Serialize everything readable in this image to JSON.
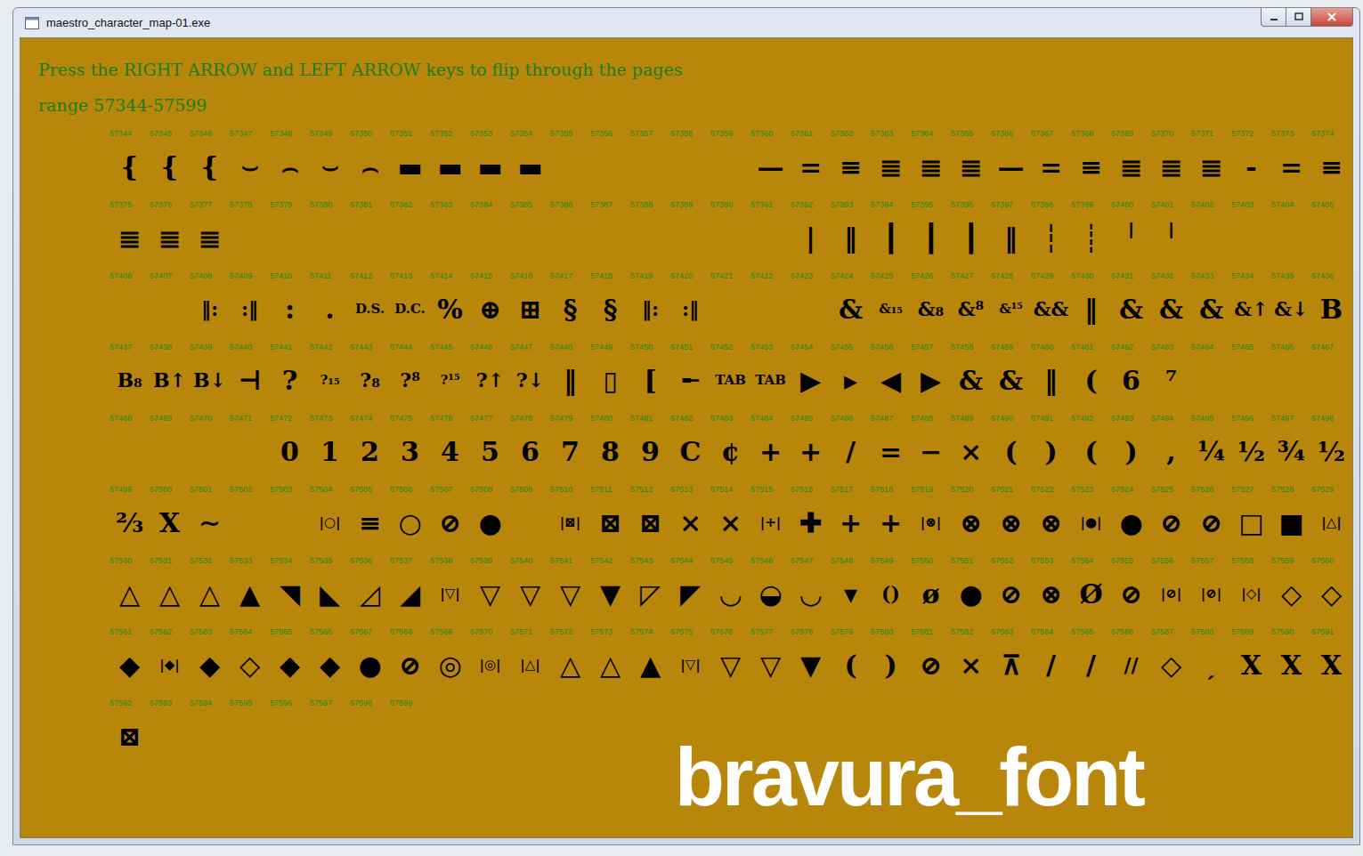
{
  "window": {
    "title": "maestro_character_map-01.exe"
  },
  "instructions": "Press the RIGHT ARROW and LEFT ARROW keys to flip through the pages",
  "range": "range 57344-57599",
  "watermark": "bravura_font",
  "rows": [
    [
      {
        "code": "57344",
        "glyph": "{"
      },
      {
        "code": "57345",
        "glyph": "{"
      },
      {
        "code": "57346",
        "glyph": "{"
      },
      {
        "code": "57347",
        "glyph": "⌣"
      },
      {
        "code": "57348",
        "glyph": "⌢"
      },
      {
        "code": "57349",
        "glyph": "⌣"
      },
      {
        "code": "57350",
        "glyph": "⌢"
      },
      {
        "code": "57351",
        "glyph": "▬"
      },
      {
        "code": "57352",
        "glyph": "▬"
      },
      {
        "code": "57353",
        "glyph": "▬"
      },
      {
        "code": "57354",
        "glyph": "▬"
      },
      {
        "code": "57355",
        "glyph": ""
      },
      {
        "code": "57356",
        "glyph": ""
      },
      {
        "code": "57357",
        "glyph": ""
      },
      {
        "code": "57358",
        "glyph": ""
      },
      {
        "code": "57359",
        "glyph": ""
      },
      {
        "code": "57360",
        "glyph": "—"
      },
      {
        "code": "57361",
        "glyph": "="
      },
      {
        "code": "57362",
        "glyph": "≡"
      },
      {
        "code": "57363",
        "glyph": "≣"
      },
      {
        "code": "57364",
        "glyph": "≣"
      },
      {
        "code": "57365",
        "glyph": "≣"
      },
      {
        "code": "57366",
        "glyph": "—"
      },
      {
        "code": "57367",
        "glyph": "="
      },
      {
        "code": "57368",
        "glyph": "≡"
      },
      {
        "code": "57369",
        "glyph": "≣"
      },
      {
        "code": "57370",
        "glyph": "≣"
      },
      {
        "code": "57371",
        "glyph": "≣"
      },
      {
        "code": "57372",
        "glyph": "-"
      },
      {
        "code": "57373",
        "glyph": "="
      },
      {
        "code": "57374",
        "glyph": "≡"
      }
    ],
    [
      {
        "code": "57375",
        "glyph": "≣"
      },
      {
        "code": "57376",
        "glyph": "≣"
      },
      {
        "code": "57377",
        "glyph": "≣"
      },
      {
        "code": "57378",
        "glyph": ""
      },
      {
        "code": "57379",
        "glyph": ""
      },
      {
        "code": "57380",
        "glyph": ""
      },
      {
        "code": "57381",
        "glyph": ""
      },
      {
        "code": "57382",
        "glyph": ""
      },
      {
        "code": "57383",
        "glyph": ""
      },
      {
        "code": "57384",
        "glyph": ""
      },
      {
        "code": "57385",
        "glyph": ""
      },
      {
        "code": "57386",
        "glyph": ""
      },
      {
        "code": "57387",
        "glyph": ""
      },
      {
        "code": "57388",
        "glyph": ""
      },
      {
        "code": "57389",
        "glyph": ""
      },
      {
        "code": "57390",
        "glyph": ""
      },
      {
        "code": "57391",
        "glyph": ""
      },
      {
        "code": "57392",
        "glyph": "|"
      },
      {
        "code": "57393",
        "glyph": "‖"
      },
      {
        "code": "57394",
        "glyph": "┃"
      },
      {
        "code": "57395",
        "glyph": "┃"
      },
      {
        "code": "57396",
        "glyph": "┃"
      },
      {
        "code": "57397",
        "glyph": "‖"
      },
      {
        "code": "57398",
        "glyph": "┆"
      },
      {
        "code": "57399",
        "glyph": "┊"
      },
      {
        "code": "57400",
        "glyph": "╵"
      },
      {
        "code": "57401",
        "glyph": "╵"
      },
      {
        "code": "57402",
        "glyph": ""
      },
      {
        "code": "57403",
        "glyph": ""
      },
      {
        "code": "57404",
        "glyph": ""
      },
      {
        "code": "57405",
        "glyph": ""
      }
    ],
    [
      {
        "code": "57406",
        "glyph": ""
      },
      {
        "code": "57407",
        "glyph": ""
      },
      {
        "code": "57408",
        "glyph": "‖:"
      },
      {
        "code": "57409",
        "glyph": ":‖"
      },
      {
        "code": "57410",
        "glyph": ":"
      },
      {
        "code": "57411",
        "glyph": "."
      },
      {
        "code": "57412",
        "glyph": "D.S."
      },
      {
        "code": "57413",
        "glyph": "D.C."
      },
      {
        "code": "57414",
        "glyph": "%"
      },
      {
        "code": "57415",
        "glyph": "⊕"
      },
      {
        "code": "57416",
        "glyph": "⊞"
      },
      {
        "code": "57417",
        "glyph": "§"
      },
      {
        "code": "57418",
        "glyph": "§"
      },
      {
        "code": "57419",
        "glyph": "‖:"
      },
      {
        "code": "57420",
        "glyph": ":‖"
      },
      {
        "code": "57421",
        "glyph": ""
      },
      {
        "code": "57422",
        "glyph": ""
      },
      {
        "code": "57423",
        "glyph": ""
      },
      {
        "code": "57424",
        "glyph": "&"
      },
      {
        "code": "57425",
        "glyph": "&₁₅"
      },
      {
        "code": "57426",
        "glyph": "&₈"
      },
      {
        "code": "57427",
        "glyph": "&⁸"
      },
      {
        "code": "57428",
        "glyph": "&¹⁵"
      },
      {
        "code": "57429",
        "glyph": "&&"
      },
      {
        "code": "57430",
        "glyph": "‖"
      },
      {
        "code": "57431",
        "glyph": "&"
      },
      {
        "code": "57432",
        "glyph": "&"
      },
      {
        "code": "57433",
        "glyph": "&"
      },
      {
        "code": "57434",
        "glyph": "&↑"
      },
      {
        "code": "57435",
        "glyph": "&↓"
      },
      {
        "code": "57436",
        "glyph": "B"
      }
    ],
    [
      {
        "code": "57437",
        "glyph": "B₈"
      },
      {
        "code": "57438",
        "glyph": "B↑"
      },
      {
        "code": "57439",
        "glyph": "B↓"
      },
      {
        "code": "57440",
        "glyph": "⊣"
      },
      {
        "code": "57441",
        "glyph": "?"
      },
      {
        "code": "57442",
        "glyph": "?₁₅"
      },
      {
        "code": "57443",
        "glyph": "?₈"
      },
      {
        "code": "57444",
        "glyph": "?⁸"
      },
      {
        "code": "57445",
        "glyph": "?¹⁵"
      },
      {
        "code": "57446",
        "glyph": "?↑"
      },
      {
        "code": "57447",
        "glyph": "?↓"
      },
      {
        "code": "57448",
        "glyph": "‖"
      },
      {
        "code": "57449",
        "glyph": "▯"
      },
      {
        "code": "57450",
        "glyph": "["
      },
      {
        "code": "57451",
        "glyph": "╾"
      },
      {
        "code": "57452",
        "glyph": "TAB"
      },
      {
        "code": "57453",
        "glyph": "TAB"
      },
      {
        "code": "57454",
        "glyph": "▶"
      },
      {
        "code": "57455",
        "glyph": "▸"
      },
      {
        "code": "57456",
        "glyph": "◀"
      },
      {
        "code": "57457",
        "glyph": "▶"
      },
      {
        "code": "57458",
        "glyph": "&"
      },
      {
        "code": "57459",
        "glyph": "&"
      },
      {
        "code": "57460",
        "glyph": "‖"
      },
      {
        "code": "57461",
        "glyph": "("
      },
      {
        "code": "57462",
        "glyph": "6"
      },
      {
        "code": "57463",
        "glyph": "⁷"
      },
      {
        "code": "57464",
        "glyph": ""
      },
      {
        "code": "57465",
        "glyph": ""
      },
      {
        "code": "57466",
        "glyph": ""
      },
      {
        "code": "57467",
        "glyph": ""
      }
    ],
    [
      {
        "code": "57468",
        "glyph": ""
      },
      {
        "code": "57469",
        "glyph": ""
      },
      {
        "code": "57470",
        "glyph": ""
      },
      {
        "code": "57471",
        "glyph": ""
      },
      {
        "code": "57472",
        "glyph": "0"
      },
      {
        "code": "57473",
        "glyph": "1"
      },
      {
        "code": "57474",
        "glyph": "2"
      },
      {
        "code": "57475",
        "glyph": "3"
      },
      {
        "code": "57476",
        "glyph": "4"
      },
      {
        "code": "57477",
        "glyph": "5"
      },
      {
        "code": "57478",
        "glyph": "6"
      },
      {
        "code": "57479",
        "glyph": "7"
      },
      {
        "code": "57480",
        "glyph": "8"
      },
      {
        "code": "57481",
        "glyph": "9"
      },
      {
        "code": "57482",
        "glyph": "C"
      },
      {
        "code": "57483",
        "glyph": "¢"
      },
      {
        "code": "57484",
        "glyph": "+"
      },
      {
        "code": "57485",
        "glyph": "+"
      },
      {
        "code": "57486",
        "glyph": "/"
      },
      {
        "code": "57487",
        "glyph": "="
      },
      {
        "code": "57488",
        "glyph": "−"
      },
      {
        "code": "57489",
        "glyph": "×"
      },
      {
        "code": "57490",
        "glyph": "("
      },
      {
        "code": "57491",
        "glyph": ")"
      },
      {
        "code": "57492",
        "glyph": "("
      },
      {
        "code": "57493",
        "glyph": ")"
      },
      {
        "code": "57494",
        "glyph": ","
      },
      {
        "code": "57495",
        "glyph": "¼"
      },
      {
        "code": "57496",
        "glyph": "½"
      },
      {
        "code": "57497",
        "glyph": "¾"
      },
      {
        "code": "57498",
        "glyph": "½"
      }
    ],
    [
      {
        "code": "57499",
        "glyph": "⅔"
      },
      {
        "code": "57500",
        "glyph": "X"
      },
      {
        "code": "57501",
        "glyph": "∼"
      },
      {
        "code": "57502",
        "glyph": ""
      },
      {
        "code": "57503",
        "glyph": ""
      },
      {
        "code": "57504",
        "glyph": "|○|"
      },
      {
        "code": "57505",
        "glyph": "≡"
      },
      {
        "code": "57506",
        "glyph": "○"
      },
      {
        "code": "57507",
        "glyph": "⊘"
      },
      {
        "code": "57508",
        "glyph": "●"
      },
      {
        "code": "57509",
        "glyph": ""
      },
      {
        "code": "57510",
        "glyph": "|⊠|"
      },
      {
        "code": "57511",
        "glyph": "⊠"
      },
      {
        "code": "57512",
        "glyph": "⊠"
      },
      {
        "code": "57513",
        "glyph": "×"
      },
      {
        "code": "57514",
        "glyph": "×"
      },
      {
        "code": "57515",
        "glyph": "|+|"
      },
      {
        "code": "57516",
        "glyph": "✚"
      },
      {
        "code": "57517",
        "glyph": "+"
      },
      {
        "code": "57518",
        "glyph": "+"
      },
      {
        "code": "57519",
        "glyph": "|⊗|"
      },
      {
        "code": "57520",
        "glyph": "⊗"
      },
      {
        "code": "57521",
        "glyph": "⊗"
      },
      {
        "code": "57522",
        "glyph": "⊗"
      },
      {
        "code": "57523",
        "glyph": "|●|"
      },
      {
        "code": "57524",
        "glyph": "●"
      },
      {
        "code": "57525",
        "glyph": "⊘"
      },
      {
        "code": "57526",
        "glyph": "⊘"
      },
      {
        "code": "57527",
        "glyph": "□"
      },
      {
        "code": "57528",
        "glyph": "■"
      },
      {
        "code": "57529",
        "glyph": "|△|"
      }
    ],
    [
      {
        "code": "57530",
        "glyph": "△"
      },
      {
        "code": "57531",
        "glyph": "△"
      },
      {
        "code": "57532",
        "glyph": "△"
      },
      {
        "code": "57533",
        "glyph": "▲"
      },
      {
        "code": "57534",
        "glyph": "◥"
      },
      {
        "code": "57535",
        "glyph": "◣"
      },
      {
        "code": "57536",
        "glyph": "◿"
      },
      {
        "code": "57537",
        "glyph": "◢"
      },
      {
        "code": "57538",
        "glyph": "|▽|"
      },
      {
        "code": "57539",
        "glyph": "▽"
      },
      {
        "code": "57540",
        "glyph": "▽"
      },
      {
        "code": "57541",
        "glyph": "▽"
      },
      {
        "code": "57542",
        "glyph": "▼"
      },
      {
        "code": "57543",
        "glyph": "◸"
      },
      {
        "code": "57544",
        "glyph": "◤"
      },
      {
        "code": "57545",
        "glyph": "◡"
      },
      {
        "code": "57546",
        "glyph": "◒"
      },
      {
        "code": "57547",
        "glyph": "◡"
      },
      {
        "code": "57548",
        "glyph": "▾"
      },
      {
        "code": "57549",
        "glyph": "()"
      },
      {
        "code": "57550",
        "glyph": "ø"
      },
      {
        "code": "57551",
        "glyph": "●"
      },
      {
        "code": "57552",
        "glyph": "⊘"
      },
      {
        "code": "57553",
        "glyph": "⊗"
      },
      {
        "code": "57554",
        "glyph": "Ø"
      },
      {
        "code": "57555",
        "glyph": "⊘"
      },
      {
        "code": "57556",
        "glyph": "|⊘|"
      },
      {
        "code": "57557",
        "glyph": "|⊘|"
      },
      {
        "code": "57558",
        "glyph": "|◇|"
      },
      {
        "code": "57559",
        "glyph": "◇"
      },
      {
        "code": "57560",
        "glyph": "◇"
      }
    ],
    [
      {
        "code": "57561",
        "glyph": "◆"
      },
      {
        "code": "57562",
        "glyph": "|◆|"
      },
      {
        "code": "57563",
        "glyph": "◆"
      },
      {
        "code": "57564",
        "glyph": "◇"
      },
      {
        "code": "57565",
        "glyph": "◆"
      },
      {
        "code": "57566",
        "glyph": "◆"
      },
      {
        "code": "57567",
        "glyph": "●"
      },
      {
        "code": "57568",
        "glyph": "⊘"
      },
      {
        "code": "57569",
        "glyph": "◎"
      },
      {
        "code": "57570",
        "glyph": "|◎|"
      },
      {
        "code": "57571",
        "glyph": "|△|"
      },
      {
        "code": "57572",
        "glyph": "△"
      },
      {
        "code": "57573",
        "glyph": "△"
      },
      {
        "code": "57574",
        "glyph": "▲"
      },
      {
        "code": "57575",
        "glyph": "|▽|"
      },
      {
        "code": "57576",
        "glyph": "▽"
      },
      {
        "code": "57577",
        "glyph": "▽"
      },
      {
        "code": "57578",
        "glyph": "▼"
      },
      {
        "code": "57579",
        "glyph": "("
      },
      {
        "code": "57580",
        "glyph": ")"
      },
      {
        "code": "57581",
        "glyph": "⊘"
      },
      {
        "code": "57582",
        "glyph": "×"
      },
      {
        "code": "57583",
        "glyph": "⊼"
      },
      {
        "code": "57584",
        "glyph": "/"
      },
      {
        "code": "57585",
        "glyph": "/"
      },
      {
        "code": "57586",
        "glyph": "//"
      },
      {
        "code": "57587",
        "glyph": "◇"
      },
      {
        "code": "57588",
        "glyph": "ˏ"
      },
      {
        "code": "57589",
        "glyph": "X"
      },
      {
        "code": "57590",
        "glyph": "X"
      },
      {
        "code": "57591",
        "glyph": "X"
      }
    ],
    [
      {
        "code": "57592",
        "glyph": "⊠"
      },
      {
        "code": "57593",
        "glyph": ""
      },
      {
        "code": "57594",
        "glyph": ""
      },
      {
        "code": "57595",
        "glyph": ""
      },
      {
        "code": "57596",
        "glyph": ""
      },
      {
        "code": "57597",
        "glyph": ""
      },
      {
        "code": "57598",
        "glyph": ""
      },
      {
        "code": "57599",
        "glyph": ""
      }
    ]
  ]
}
